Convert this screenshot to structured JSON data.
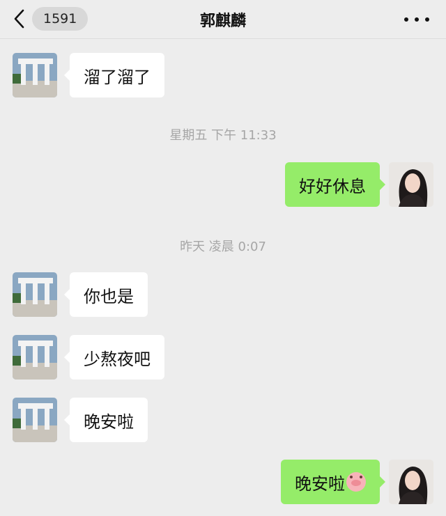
{
  "header": {
    "unread_count": "1591",
    "contact_name": "郭麒麟"
  },
  "messages": [
    {
      "sender": "contact",
      "text": "溜了溜了"
    },
    {
      "timestamp": "星期五 下午 11:33"
    },
    {
      "sender": "me",
      "text": "好好休息"
    },
    {
      "timestamp": "昨天 凌晨 0:07"
    },
    {
      "sender": "contact",
      "text": "你也是"
    },
    {
      "sender": "contact",
      "text": "少熬夜吧"
    },
    {
      "sender": "contact",
      "text": "晚安啦"
    },
    {
      "sender": "me",
      "text": "晚安啦",
      "emoji": "pig-face-icon"
    }
  ],
  "colors": {
    "background": "#ededed",
    "incoming_bubble": "#ffffff",
    "outgoing_bubble": "#95ec69",
    "timestamp_text": "#a6a6a6"
  }
}
